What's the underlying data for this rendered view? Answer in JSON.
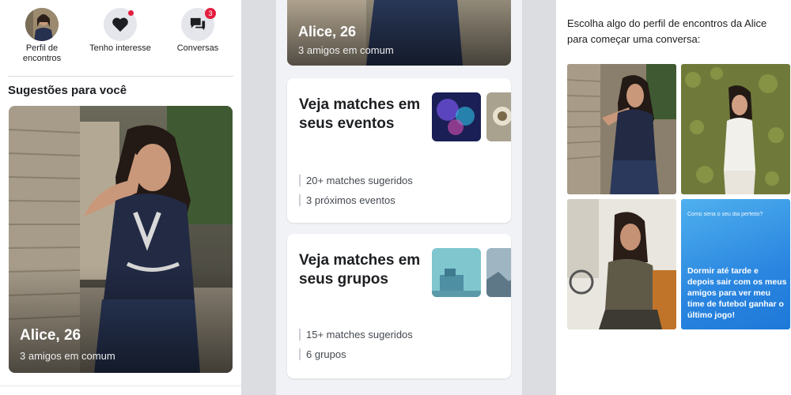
{
  "panel1": {
    "nav": [
      {
        "label": "Perfil de encontros"
      },
      {
        "label": "Tenho interesse"
      },
      {
        "label": "Conversas",
        "badge": "3"
      }
    ],
    "section_title": "Sugestões para você",
    "profile": {
      "name": "Alice, 26",
      "mutual": "3 amigos em comum"
    }
  },
  "panel2": {
    "profile": {
      "name": "Alice, 26",
      "mutual": "3 amigos em comum"
    },
    "events_card": {
      "title": "Veja matches em seus eventos",
      "stats": [
        "20+ matches sugeridos",
        "3 próximos eventos"
      ]
    },
    "groups_card": {
      "title": "Veja matches em seus grupos",
      "stats": [
        "15+ matches sugeridos",
        "6 grupos"
      ]
    }
  },
  "panel3": {
    "intro": "Escolha algo do perfil de encontros da Alice para começar uma conversa:",
    "prompt_question": "Como seria o seu dia perfeito?",
    "prompt_answer": "Dormir até tarde e depois sair com os meus amigos para ver meu time de futebol ganhar o último jogo!"
  },
  "colors": {
    "notification": "#e41e3f",
    "prompt_blue": "#2a86e0"
  }
}
